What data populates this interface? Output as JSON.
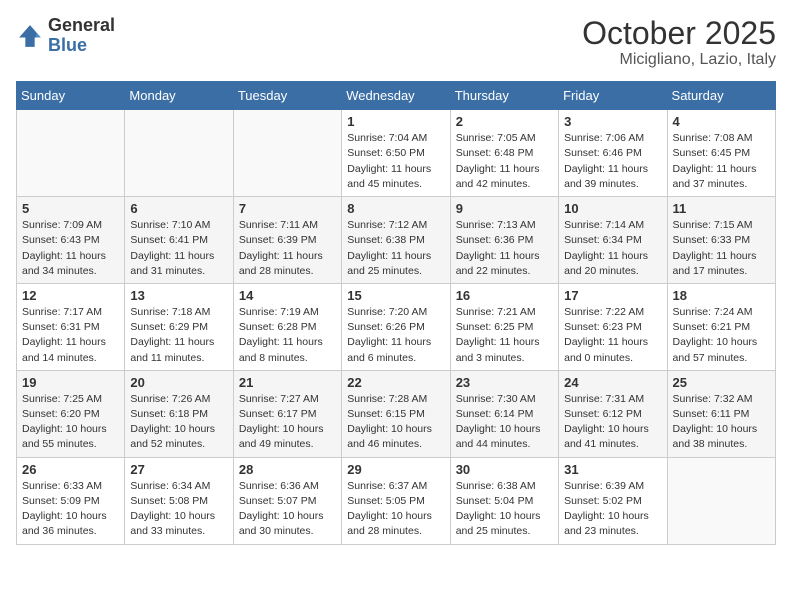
{
  "header": {
    "logo_general": "General",
    "logo_blue": "Blue",
    "month": "October 2025",
    "location": "Micigliano, Lazio, Italy"
  },
  "days_of_week": [
    "Sunday",
    "Monday",
    "Tuesday",
    "Wednesday",
    "Thursday",
    "Friday",
    "Saturday"
  ],
  "weeks": [
    [
      {
        "day": "",
        "info": ""
      },
      {
        "day": "",
        "info": ""
      },
      {
        "day": "",
        "info": ""
      },
      {
        "day": "1",
        "info": "Sunrise: 7:04 AM\nSunset: 6:50 PM\nDaylight: 11 hours\nand 45 minutes."
      },
      {
        "day": "2",
        "info": "Sunrise: 7:05 AM\nSunset: 6:48 PM\nDaylight: 11 hours\nand 42 minutes."
      },
      {
        "day": "3",
        "info": "Sunrise: 7:06 AM\nSunset: 6:46 PM\nDaylight: 11 hours\nand 39 minutes."
      },
      {
        "day": "4",
        "info": "Sunrise: 7:08 AM\nSunset: 6:45 PM\nDaylight: 11 hours\nand 37 minutes."
      }
    ],
    [
      {
        "day": "5",
        "info": "Sunrise: 7:09 AM\nSunset: 6:43 PM\nDaylight: 11 hours\nand 34 minutes."
      },
      {
        "day": "6",
        "info": "Sunrise: 7:10 AM\nSunset: 6:41 PM\nDaylight: 11 hours\nand 31 minutes."
      },
      {
        "day": "7",
        "info": "Sunrise: 7:11 AM\nSunset: 6:39 PM\nDaylight: 11 hours\nand 28 minutes."
      },
      {
        "day": "8",
        "info": "Sunrise: 7:12 AM\nSunset: 6:38 PM\nDaylight: 11 hours\nand 25 minutes."
      },
      {
        "day": "9",
        "info": "Sunrise: 7:13 AM\nSunset: 6:36 PM\nDaylight: 11 hours\nand 22 minutes."
      },
      {
        "day": "10",
        "info": "Sunrise: 7:14 AM\nSunset: 6:34 PM\nDaylight: 11 hours\nand 20 minutes."
      },
      {
        "day": "11",
        "info": "Sunrise: 7:15 AM\nSunset: 6:33 PM\nDaylight: 11 hours\nand 17 minutes."
      }
    ],
    [
      {
        "day": "12",
        "info": "Sunrise: 7:17 AM\nSunset: 6:31 PM\nDaylight: 11 hours\nand 14 minutes."
      },
      {
        "day": "13",
        "info": "Sunrise: 7:18 AM\nSunset: 6:29 PM\nDaylight: 11 hours\nand 11 minutes."
      },
      {
        "day": "14",
        "info": "Sunrise: 7:19 AM\nSunset: 6:28 PM\nDaylight: 11 hours\nand 8 minutes."
      },
      {
        "day": "15",
        "info": "Sunrise: 7:20 AM\nSunset: 6:26 PM\nDaylight: 11 hours\nand 6 minutes."
      },
      {
        "day": "16",
        "info": "Sunrise: 7:21 AM\nSunset: 6:25 PM\nDaylight: 11 hours\nand 3 minutes."
      },
      {
        "day": "17",
        "info": "Sunrise: 7:22 AM\nSunset: 6:23 PM\nDaylight: 11 hours\nand 0 minutes."
      },
      {
        "day": "18",
        "info": "Sunrise: 7:24 AM\nSunset: 6:21 PM\nDaylight: 10 hours\nand 57 minutes."
      }
    ],
    [
      {
        "day": "19",
        "info": "Sunrise: 7:25 AM\nSunset: 6:20 PM\nDaylight: 10 hours\nand 55 minutes."
      },
      {
        "day": "20",
        "info": "Sunrise: 7:26 AM\nSunset: 6:18 PM\nDaylight: 10 hours\nand 52 minutes."
      },
      {
        "day": "21",
        "info": "Sunrise: 7:27 AM\nSunset: 6:17 PM\nDaylight: 10 hours\nand 49 minutes."
      },
      {
        "day": "22",
        "info": "Sunrise: 7:28 AM\nSunset: 6:15 PM\nDaylight: 10 hours\nand 46 minutes."
      },
      {
        "day": "23",
        "info": "Sunrise: 7:30 AM\nSunset: 6:14 PM\nDaylight: 10 hours\nand 44 minutes."
      },
      {
        "day": "24",
        "info": "Sunrise: 7:31 AM\nSunset: 6:12 PM\nDaylight: 10 hours\nand 41 minutes."
      },
      {
        "day": "25",
        "info": "Sunrise: 7:32 AM\nSunset: 6:11 PM\nDaylight: 10 hours\nand 38 minutes."
      }
    ],
    [
      {
        "day": "26",
        "info": "Sunrise: 6:33 AM\nSunset: 5:09 PM\nDaylight: 10 hours\nand 36 minutes."
      },
      {
        "day": "27",
        "info": "Sunrise: 6:34 AM\nSunset: 5:08 PM\nDaylight: 10 hours\nand 33 minutes."
      },
      {
        "day": "28",
        "info": "Sunrise: 6:36 AM\nSunset: 5:07 PM\nDaylight: 10 hours\nand 30 minutes."
      },
      {
        "day": "29",
        "info": "Sunrise: 6:37 AM\nSunset: 5:05 PM\nDaylight: 10 hours\nand 28 minutes."
      },
      {
        "day": "30",
        "info": "Sunrise: 6:38 AM\nSunset: 5:04 PM\nDaylight: 10 hours\nand 25 minutes."
      },
      {
        "day": "31",
        "info": "Sunrise: 6:39 AM\nSunset: 5:02 PM\nDaylight: 10 hours\nand 23 minutes."
      },
      {
        "day": "",
        "info": ""
      }
    ]
  ]
}
